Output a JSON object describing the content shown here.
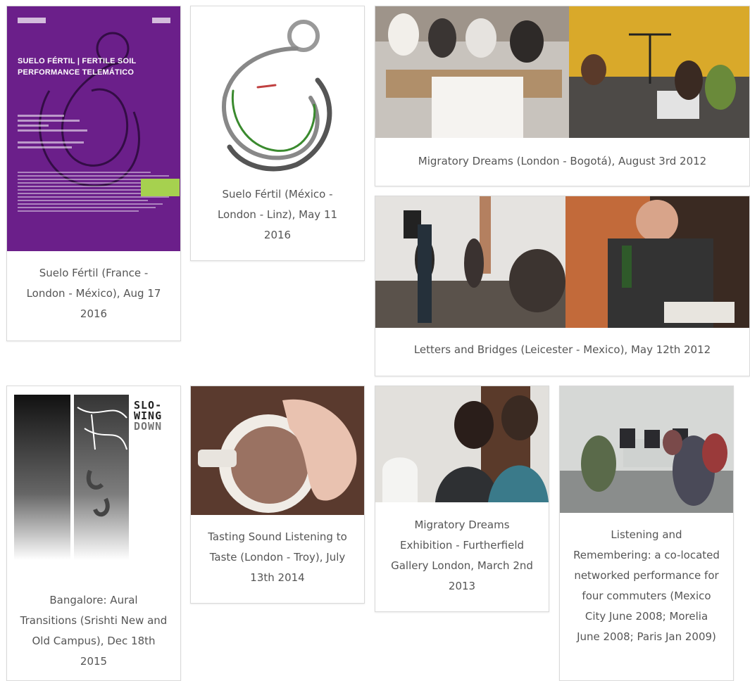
{
  "gallery": {
    "items": [
      {
        "caption": "Suelo Fértil (France - London - México), Aug 17 2016"
      },
      {
        "caption": "Suelo Fértil (México - London - Linz), May 11 2016"
      },
      {
        "caption": "Migratory Dreams (London - Bogotá), August 3rd 2012"
      },
      {
        "caption": "Letters and Bridges (Leicester - Mexico), May 12th 2012"
      },
      {
        "caption": "Bangalore: Aural Transitions (Srishti New and Old Campus), Dec 18th 2015"
      },
      {
        "caption": "Tasting Sound Listening to Taste (London - Troy), July 13th 2014"
      },
      {
        "caption": "Migratory Dreams Exhibition - Furtherfield Gallery London, March 2nd 2013"
      },
      {
        "caption": "Listening and Remembering: a co-located networked performance for four commuters (Mexico City June 2008; Morelia June 2008; Paris Jan 2009)"
      }
    ]
  },
  "poster": {
    "title": "SUELO FÉRTIL | FERTILE SOIL PERFORMANCE TELEMÁTICO"
  },
  "slowing_down": {
    "line1": "SLO-",
    "line2": "WING",
    "line3": "DOWN"
  },
  "colors": {
    "poster_bg": "#6b1f8a",
    "poster_accent": "#a6d14f",
    "caption_text": "#555555",
    "card_border": "#d9d9d9"
  }
}
